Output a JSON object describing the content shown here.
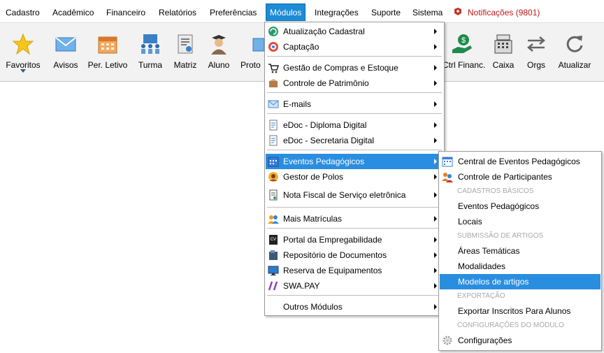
{
  "menubar": {
    "items": [
      "Cadastro",
      "Acadêmico",
      "Financeiro",
      "Relatórios",
      "Preferências",
      "Módulos",
      "Integrações",
      "Suporte",
      "Sistema"
    ],
    "notifications": "Notificações (9801)"
  },
  "toolbar": {
    "buttons": [
      "Favoritos",
      "Avisos",
      "Per. Letivo",
      "Turma",
      "Matriz",
      "Aluno",
      "Proto",
      "Ctrl Financ.",
      "Caixa",
      "Orgs",
      "Atualizar"
    ]
  },
  "modulos_menu": {
    "items": [
      {
        "label": "Atualização Cadastral",
        "icon": "refresh-icon"
      },
      {
        "label": "Captação",
        "icon": "target-icon"
      },
      {
        "label": "Gestão de Compras e Estoque",
        "icon": "cart-icon"
      },
      {
        "label": "Controle de Patrimônio",
        "icon": "box-icon"
      },
      {
        "label": "E-mails",
        "icon": "envelope-icon"
      },
      {
        "label": "eDoc - Diploma Digital",
        "icon": "document-icon"
      },
      {
        "label": "eDoc - Secretaria Digital",
        "icon": "document-icon"
      },
      {
        "label": "Eventos Pedagógicos",
        "icon": "calendar-icon"
      },
      {
        "label": "Gestor de Polos",
        "icon": "avatar-icon"
      },
      {
        "label": "Nota Fiscal de Serviço eletrônica",
        "icon": "invoice-icon"
      },
      {
        "label": "Mais Matrículas",
        "icon": "people-icon"
      },
      {
        "label": "Portal da Empregabilidade",
        "icon": "cv-icon"
      },
      {
        "label": "Repositório de Documentos",
        "icon": "folder-icon"
      },
      {
        "label": "Reserva de Equipamentos",
        "icon": "monitor-icon"
      },
      {
        "label": "SWA.PAY",
        "icon": "slash-icon"
      },
      {
        "label": "Outros Módulos",
        "icon": ""
      }
    ]
  },
  "eventos_submenu": {
    "items": [
      {
        "label": "Central de Eventos Pedagógicos"
      },
      {
        "label": "Controle de Participantes"
      },
      {
        "category": "CADASTROS BÁSICOS"
      },
      {
        "label": "Eventos Pedagógicos"
      },
      {
        "label": "Locais"
      },
      {
        "category": "SUBMISSÃO DE ARTIGOS"
      },
      {
        "label": "Áreas Temáticas"
      },
      {
        "label": "Modalidades"
      },
      {
        "label": "Modelos de artigos"
      },
      {
        "category": "EXPORTAÇÃO"
      },
      {
        "label": "Exportar Inscritos Para Alunos"
      },
      {
        "category": "CONFIGURAÇÕES DO MÓDULO"
      },
      {
        "label": "Configurações"
      }
    ]
  }
}
